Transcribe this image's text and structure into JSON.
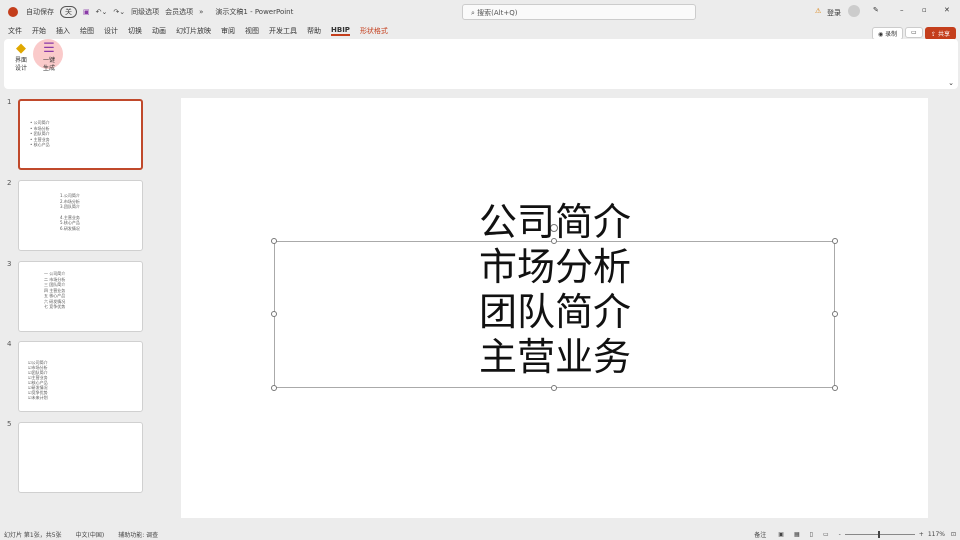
{
  "titlebar": {
    "autosave": "自动保存",
    "autosave_state": "关",
    "toolbar": [
      "同级选项",
      "会员选项"
    ],
    "title": "演示文稿1 - PowerPoint",
    "search_placeholder": "搜索(Alt+Q)",
    "signin": "登录",
    "warning_icon": "warning-icon"
  },
  "tabs": [
    "文件",
    "开始",
    "插入",
    "绘图",
    "设计",
    "切换",
    "动画",
    "幻灯片放映",
    "审阅",
    "视图",
    "开发工具",
    "帮助",
    "HBIP",
    "形状格式"
  ],
  "actions": {
    "record": "录制",
    "share": "共享"
  },
  "ribbon": {
    "buttons": [
      {
        "label": "界面设计"
      },
      {
        "label": "一键生成"
      }
    ]
  },
  "thumbnails": [
    {
      "num": "1",
      "lines": [
        "• 公司简介",
        "• 市场分析",
        "• 团队简介",
        "• 主营业务",
        "• 核心产品"
      ]
    },
    {
      "num": "2",
      "lines": [
        "1.公司简介",
        "2.市场分析",
        "3.团队简介",
        "",
        "4.主营业务",
        "5.核心产品",
        "6.研发情况"
      ]
    },
    {
      "num": "3",
      "lines": [
        "一  公司简介",
        "二  市场分析",
        "三  团队简介",
        "四  主营业务",
        "五  核心产品",
        "六  研发情况",
        "七  竞争优势"
      ]
    },
    {
      "num": "4",
      "lines": [
        "☑公司简介",
        "☑市场分析",
        "☑团队简介",
        "☑主营业务",
        "☑核心产品",
        "☑研发情况",
        "☑竞争优势",
        "☑未来计划"
      ]
    },
    {
      "num": "5",
      "lines": []
    }
  ],
  "slide": {
    "lines": [
      "公司简介",
      "市场分析",
      "团队简介",
      "主营业务"
    ]
  },
  "status": {
    "slide_info": "幻灯片 第1张，共5张",
    "language": "中文(中国)",
    "accessibility": "辅助功能: 调查",
    "notes": "备注",
    "zoom": "117%"
  },
  "colors": {
    "accent": "#c43e1c"
  }
}
